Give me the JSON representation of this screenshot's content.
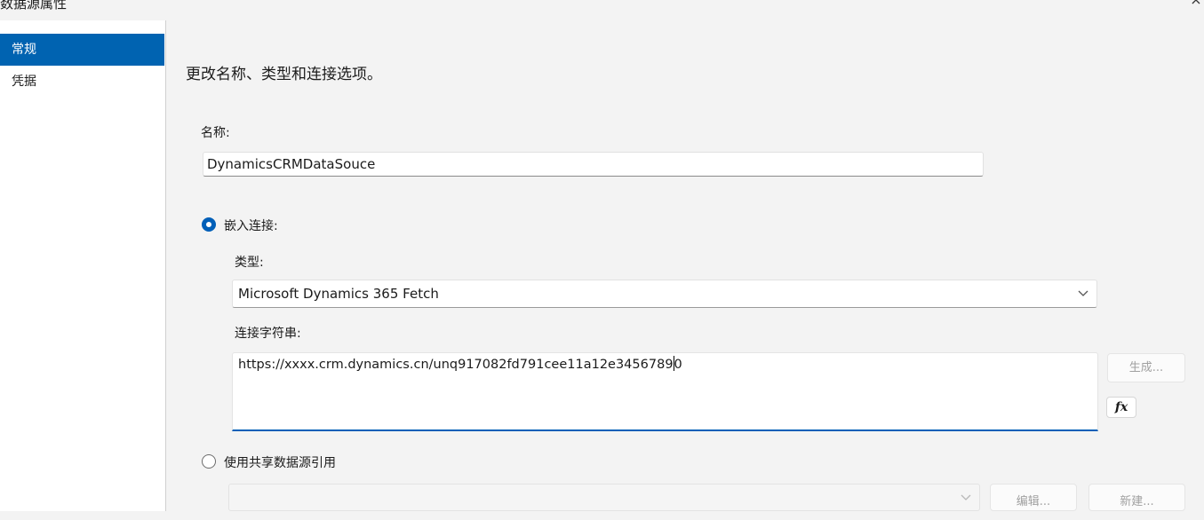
{
  "window": {
    "title": "数据源属性",
    "close_glyph": "×"
  },
  "sidebar": {
    "items": [
      {
        "label": "常规",
        "selected": true
      },
      {
        "label": "凭据",
        "selected": false
      }
    ]
  },
  "content": {
    "heading": "更改名称、类型和连接选项。",
    "name_label": "名称:",
    "name_value": "DynamicsCRMDataSouce",
    "embedded_radio_label": "嵌入连接:",
    "embedded_selected": true,
    "type_label": "类型:",
    "type_value": "Microsoft Dynamics 365 Fetch",
    "conn_label": "连接字符串:",
    "conn_value_before_caret": "https://xxxx.crm.dynamics.cn/unq917082fd791cee11a12e3456789",
    "conn_value_after_caret": "0",
    "generate_button": "生成...",
    "fx_button": "fx",
    "shared_radio_label": "使用共享数据源引用",
    "shared_selected": false,
    "shared_combo_value": "",
    "edit_button": "编辑...",
    "new_button": "新建..."
  },
  "colors": {
    "accent": "#005fb8",
    "selected_nav": "#0063b1",
    "background": "#f3f3f3"
  }
}
